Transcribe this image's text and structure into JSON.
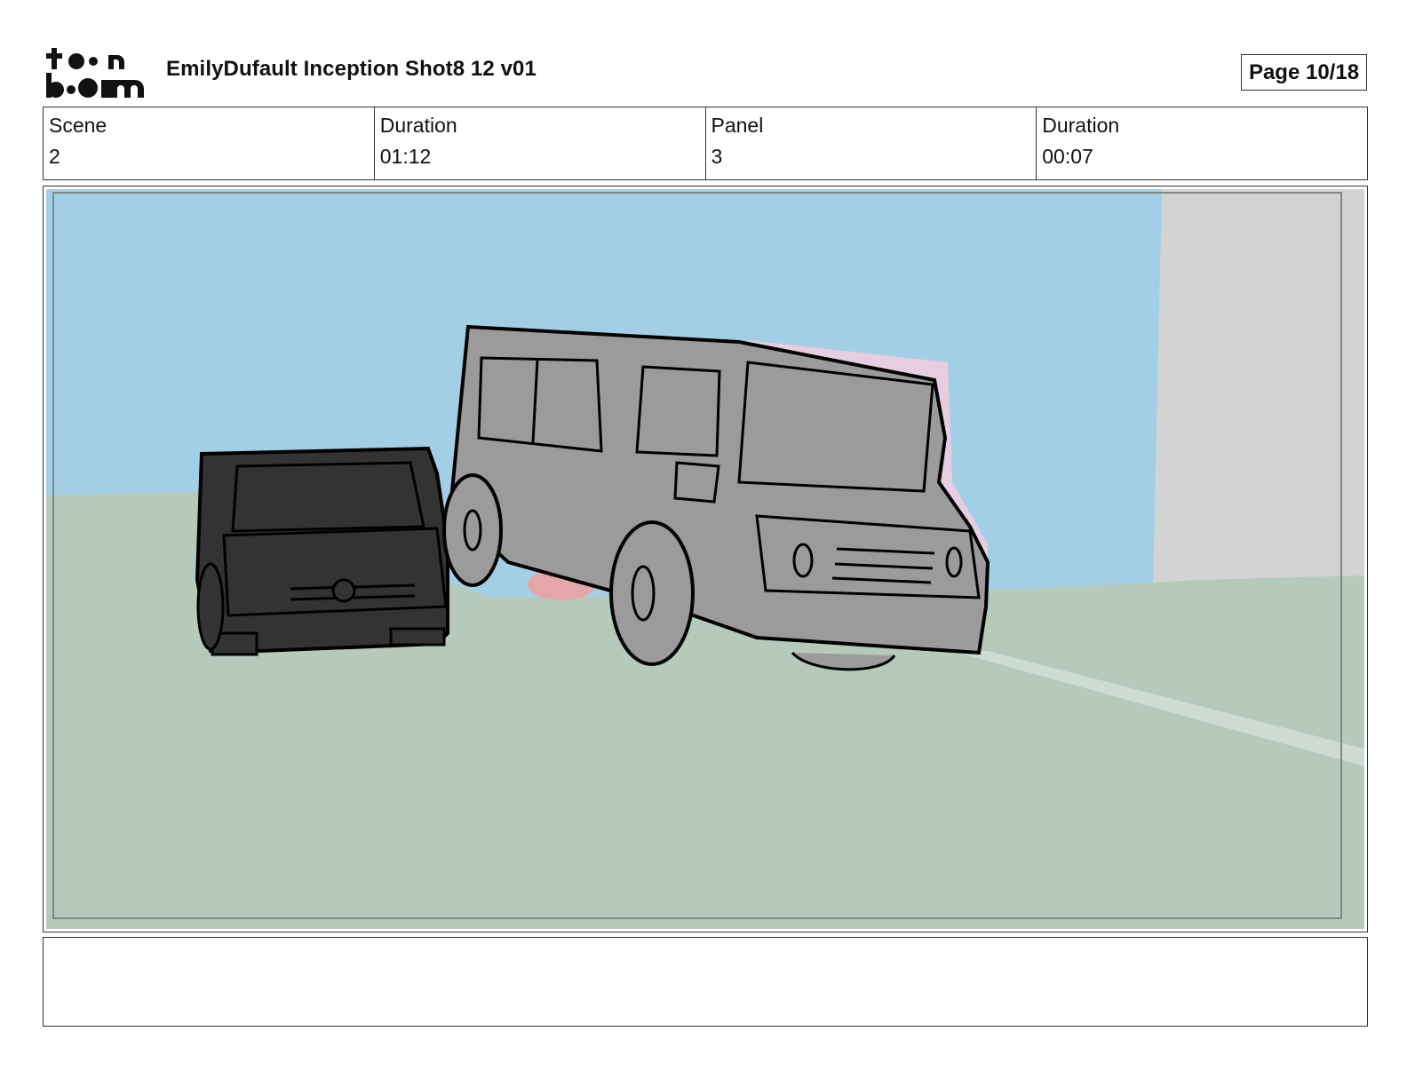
{
  "header": {
    "logo_text": "toon boom",
    "title": "EmilyDufault Inception Shot8 12 v01",
    "page": "Page 10/18"
  },
  "info": [
    {
      "label": "Scene",
      "value": "2"
    },
    {
      "label": "Duration",
      "value": "01:12"
    },
    {
      "label": "Panel",
      "value": "3"
    },
    {
      "label": "Duration",
      "value": "00:07"
    }
  ],
  "panel": {
    "colors": {
      "sky": "#a3cfe6",
      "ground": "#b5cabb",
      "wall": "#d3d3d3",
      "dark_vehicle": "#333333",
      "grey_vehicle": "#9b9b9b",
      "outline": "#000000"
    }
  },
  "notes": {
    "text": ""
  }
}
